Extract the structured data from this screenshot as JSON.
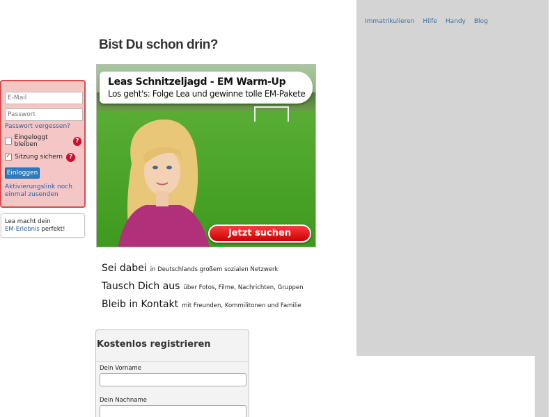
{
  "topnav": {
    "items": [
      "Immatrikulieren",
      "Hilfe",
      "Handy",
      "Blog"
    ]
  },
  "headline": "Bist Du schon drin?",
  "login": {
    "email_placeholder": "E-Mail",
    "password_placeholder": "Passwort",
    "forgot_link": "Passwort vergessen?",
    "stay_logged_in": {
      "label": "Eingeloggt bleiben",
      "checked": false
    },
    "secure_session": {
      "label": "Sitzung sichern",
      "checked": true
    },
    "submit": "Einloggen",
    "activation_link": "Aktivierungslink noch einmal zusenden"
  },
  "lea_box": {
    "pre": "Lea macht dein",
    "link": "EM-Erlebnis",
    "post": " perfekt!"
  },
  "banner": {
    "headline": "Leas Schnitzeljagd - EM Warm-Up",
    "subline": "Los geht's: Folge Lea und gewinne tolle EM-Pakete",
    "cta": "Jetzt suchen"
  },
  "features": [
    {
      "title": "Sei dabei",
      "desc": "in Deutschlands großem sozialen Netzwerk"
    },
    {
      "title": "Tausch Dich aus",
      "desc": "über Fotos, Filme, Nachrichten, Gruppen"
    },
    {
      "title": "Bleib in Kontakt",
      "desc": "mit Freunden, Kommilitonen und Familie"
    }
  ],
  "register": {
    "title": "Kostenlos registrieren",
    "firstname_label": "Dein Vorname",
    "lastname_label": "Dein Nachname"
  },
  "colors": {
    "login_bg": "#f5c6c6",
    "login_border": "#d94c4c",
    "cta_red": "#e00000",
    "link_blue": "#2a5f9e",
    "side_gray": "#d4d4d4"
  }
}
